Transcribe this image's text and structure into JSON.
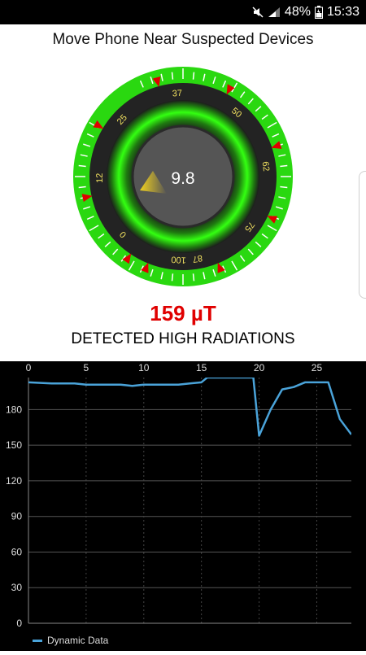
{
  "status": {
    "battery": "48%",
    "time": "15:33"
  },
  "prompt": "Move Phone Near Suspected Devices",
  "gauge": {
    "value": "9.8",
    "scale_labels": [
      "0",
      "12",
      "25",
      "37",
      "50",
      "62",
      "75",
      "87",
      "100"
    ],
    "colors": {
      "ring": "#22ee00",
      "marker": "#e00000",
      "dial": "#555555",
      "pointer": "#e6c020"
    }
  },
  "reading": "159 µT",
  "detected_text": "DETECTED HIGH RADIATIONS",
  "chart_data": {
    "type": "line",
    "x_ticks": [
      0,
      5,
      10,
      15,
      20,
      25
    ],
    "y_ticks": [
      0,
      30,
      60,
      90,
      120,
      150,
      180
    ],
    "xlim": [
      0,
      28
    ],
    "ylim": [
      0,
      207
    ],
    "grid": true,
    "series": [
      {
        "name": "Dynamic Data",
        "color": "#4aa3d9",
        "points": [
          [
            0,
            203
          ],
          [
            2,
            202
          ],
          [
            4,
            202
          ],
          [
            5,
            201
          ],
          [
            6,
            201
          ],
          [
            8,
            201
          ],
          [
            9,
            200
          ],
          [
            10,
            201
          ],
          [
            12,
            201
          ],
          [
            13,
            201
          ],
          [
            14,
            202
          ],
          [
            15,
            203
          ],
          [
            15.5,
            207
          ],
          [
            19.5,
            207
          ],
          [
            20,
            158
          ],
          [
            21,
            180
          ],
          [
            22,
            197
          ],
          [
            23,
            199
          ],
          [
            24,
            203
          ],
          [
            26,
            203
          ],
          [
            27,
            172
          ],
          [
            28,
            159
          ]
        ]
      }
    ]
  }
}
